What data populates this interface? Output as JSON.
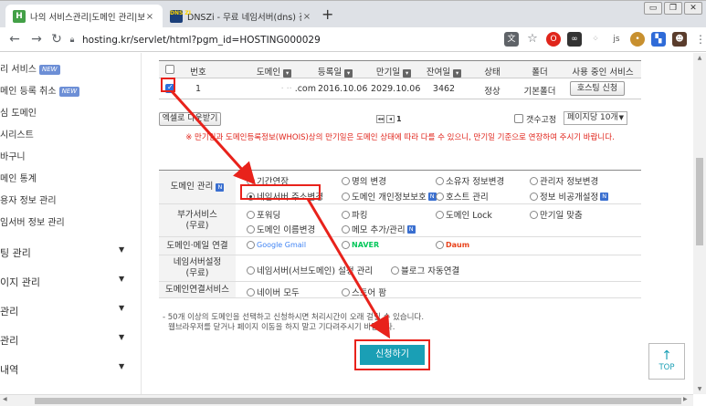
{
  "browser": {
    "tabs": [
      {
        "title": "나의 서비스관리|도메인 관리|보…",
        "favicon": "H",
        "active": true
      },
      {
        "title": "DNSZi - 무료 네임서버(dns) 관리",
        "favicon": "DNS ZI",
        "active": false
      }
    ],
    "close_glyph": "×",
    "newtab_glyph": "+",
    "window_controls": [
      "▭",
      "❐",
      "✕"
    ],
    "url": "hosting.kr/servlet/html?pgm_id=HOSTING000029",
    "extension_icons": [
      "translate-icon",
      "star-icon",
      "opera-icon",
      "mask-icon",
      "dots-icon",
      "js-icon",
      "cookie-icon",
      "flag-icon",
      "profile-avatar",
      "menu-icon"
    ]
  },
  "sidebar": {
    "new_badge": "NEW",
    "items": [
      {
        "label": "리 서비스",
        "new": true
      },
      {
        "label": "메인 등록 취소",
        "new": true
      },
      {
        "label": "심 도메인",
        "new": false
      },
      {
        "label": "시리스트",
        "new": false
      },
      {
        "label": "바구니",
        "new": false
      },
      {
        "label": "메인 통계",
        "new": false
      },
      {
        "label": "용자 정보 관리",
        "new": false
      },
      {
        "label": "임서버 정보 관리",
        "new": false
      }
    ],
    "sections": [
      {
        "label": "팅 관리"
      },
      {
        "label": "이지 관리"
      },
      {
        "label": "관리"
      },
      {
        "label": "관리"
      },
      {
        "label": "내역"
      }
    ]
  },
  "domain_table": {
    "headers": {
      "no": "번호",
      "domain": "도메인",
      "registered": "등록일",
      "expires": "만기일",
      "days_left": "잔여일",
      "status": "상태",
      "folder": "폴더",
      "service": "사용 중인 서비스"
    },
    "rows": [
      {
        "checked": true,
        "no": "1",
        "domain": ".com",
        "registered": "2016.10.06",
        "expires": "2029.10.06",
        "days_left": "3462",
        "status": "정상",
        "folder": "기본폴더",
        "service_button": "호스팅 신청"
      }
    ]
  },
  "list_controls": {
    "excel_button": "엑셀로 다운받기",
    "page_number": "1",
    "count_fixed_label": "갯수고정",
    "per_page_value": "페이지당 10개",
    "notice": "※ 만기일과 도메인등록정보(WHOIS)상의 만기일은 도메인 상태에 따라 다를 수 있으니, 만기일 기준으로 연장하여 주시기 바랍니다."
  },
  "services": {
    "rows": [
      {
        "label": [
          "도메인 관리"
        ],
        "label_badge": "N",
        "options": [
          {
            "text": "기간연장",
            "selected": false,
            "badge": false
          },
          {
            "text": "명의 변경",
            "selected": false,
            "badge": false
          },
          {
            "text": "소유자 정보변경",
            "selected": false,
            "badge": false
          },
          {
            "text": "관리자 정보변경",
            "selected": false,
            "badge": false
          },
          {
            "text": "네임서버 주소변경",
            "selected": true,
            "badge": false
          },
          {
            "text": "도메인 개인정보보호",
            "selected": false,
            "badge": true
          },
          {
            "text": "호스트 관리",
            "selected": false,
            "badge": false
          },
          {
            "text": "정보 비공개설정",
            "selected": false,
            "badge": true
          }
        ]
      },
      {
        "label": [
          "부가서비스",
          "(무료)"
        ],
        "label_badge": "",
        "options": [
          {
            "text": "포워딩",
            "selected": false,
            "badge": false
          },
          {
            "text": "파킹",
            "selected": false,
            "badge": false
          },
          {
            "text": "도메인 Lock",
            "selected": false,
            "badge": false
          },
          {
            "text": "만기일 맞춤",
            "selected": false,
            "badge": false
          },
          {
            "text": "도메인 이름변경",
            "selected": false,
            "badge": false
          },
          {
            "text": "메모 추가/관리",
            "selected": false,
            "badge": true
          }
        ]
      },
      {
        "label": [
          "도메인·메일 연결"
        ],
        "label_badge": "",
        "options": [
          {
            "text": "Google Gmail",
            "selected": false,
            "badge": false
          },
          {
            "text": "NAVER",
            "selected": false,
            "badge": false
          },
          {
            "text": "Daum",
            "selected": false,
            "badge": false
          }
        ]
      },
      {
        "label": [
          "네임서버설정",
          "(무료)"
        ],
        "label_badge": "",
        "options": [
          {
            "text": "네임서버(서브도메인) 설정 관리",
            "selected": false,
            "badge": false
          },
          {
            "text": "블로그 자동연결",
            "selected": false,
            "badge": false
          }
        ]
      },
      {
        "label": [
          "도메인연결서비스"
        ],
        "label_badge": "",
        "options": [
          {
            "text": "네이버 모두",
            "selected": false,
            "badge": false
          },
          {
            "text": "스토어 팜",
            "selected": false,
            "badge": false
          }
        ]
      }
    ],
    "badge_glyph": "N"
  },
  "footer": {
    "note_line1": "- 50개 이상의 도메인을 선택하고 신청하시면 처리시간이 오래 걸릴 수 있습니다.",
    "note_line2": "웹브라우저를 닫거나 페이지 이동을 하지 말고 기다려주시기 바랍니다.",
    "apply_button": "신청하기",
    "top_button": "TOP",
    "top_arrow": "↑"
  },
  "colors": {
    "annotation_red": "#e8221b",
    "apply_teal": "#1a9fb5",
    "checkbox_blue": "#2c6fdd"
  }
}
